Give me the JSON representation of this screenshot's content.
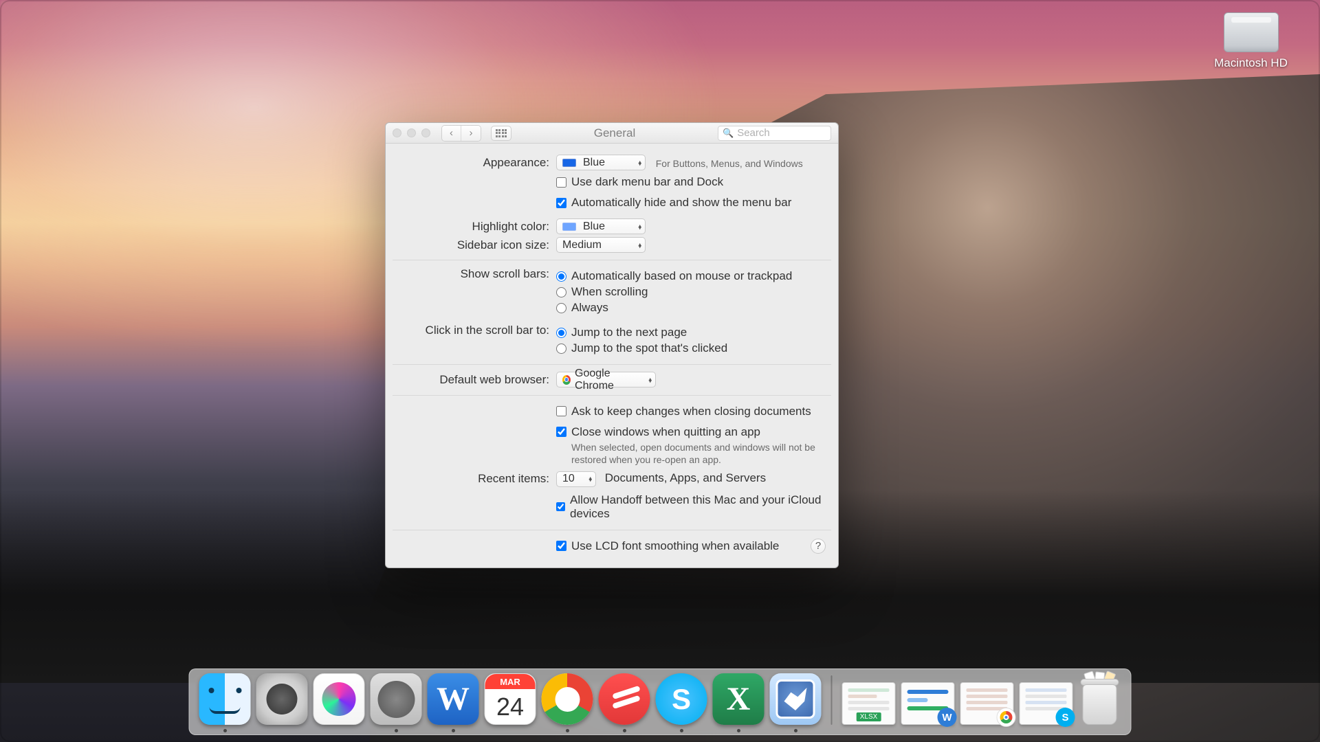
{
  "desktop": {
    "hd_label": "Macintosh HD"
  },
  "window": {
    "title": "General",
    "search_placeholder": "Search"
  },
  "prefs": {
    "appearance_label": "Appearance:",
    "appearance_value": "Blue",
    "appearance_hint": "For Buttons, Menus, and Windows",
    "dark_menu": "Use dark menu bar and Dock",
    "auto_hide_menu": "Automatically hide and show the menu bar",
    "highlight_label": "Highlight color:",
    "highlight_value": "Blue",
    "sidebar_label": "Sidebar icon size:",
    "sidebar_value": "Medium",
    "scroll_label": "Show scroll bars:",
    "scroll_opt1": "Automatically based on mouse or trackpad",
    "scroll_opt2": "When scrolling",
    "scroll_opt3": "Always",
    "click_label": "Click in the scroll bar to:",
    "click_opt1": "Jump to the next page",
    "click_opt2": "Jump to the spot that's clicked",
    "browser_label": "Default web browser:",
    "browser_value": "Google Chrome",
    "ask_changes": "Ask to keep changes when closing documents",
    "close_windows": "Close windows when quitting an app",
    "close_windows_hint": "When selected, open documents and windows will not be restored when you re-open an app.",
    "recent_label": "Recent items:",
    "recent_value": "10",
    "recent_hint": "Documents, Apps, and Servers",
    "handoff": "Allow Handoff between this Mac and your iCloud devices",
    "lcd": "Use LCD font smoothing when available"
  },
  "dock": {
    "calendar_month": "MAR",
    "calendar_day": "24",
    "xlsx_tag": "XLSX"
  }
}
